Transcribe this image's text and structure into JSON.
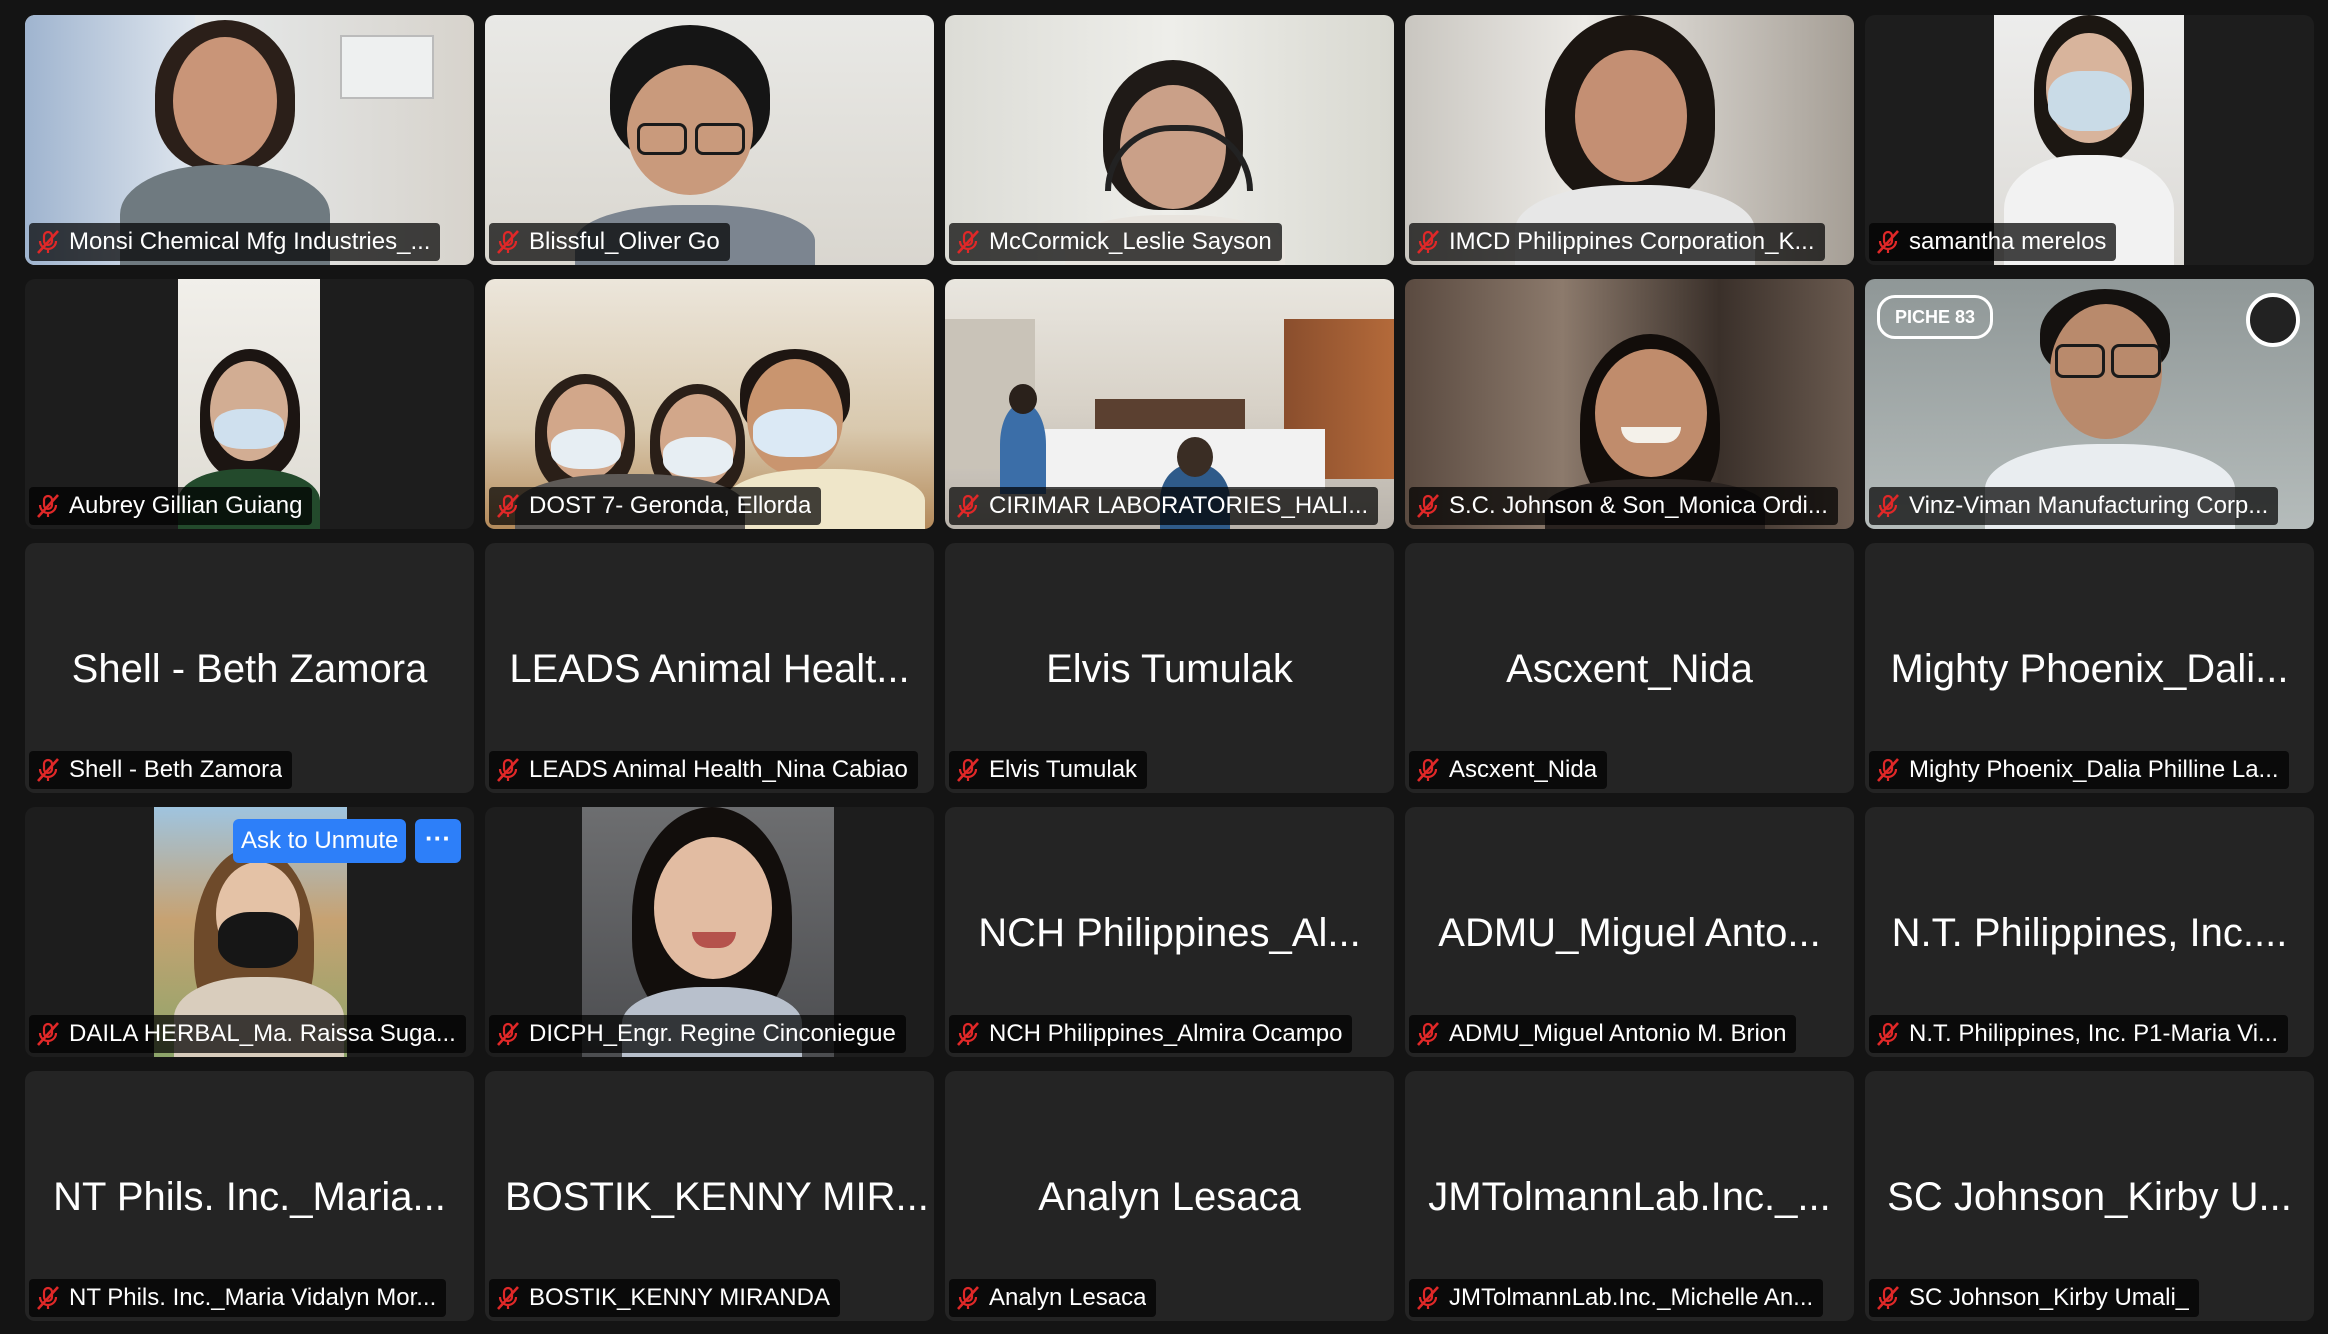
{
  "participants": [
    {
      "id": "t1",
      "name": "Monsi Chemical Mfg Industries_..."
    },
    {
      "id": "t2",
      "name": "Blissful_Oliver Go"
    },
    {
      "id": "t3",
      "name": "McCormick_Leslie Sayson"
    },
    {
      "id": "t4",
      "name": "IMCD Philippines Corporation_K..."
    },
    {
      "id": "t5",
      "name": "samantha merelos"
    },
    {
      "id": "t6",
      "name": "Aubrey Gillian Guiang"
    },
    {
      "id": "t7",
      "name": "DOST 7- Geronda, Ellorda"
    },
    {
      "id": "t8",
      "name": "CIRIMAR LABORATORIES_HALI..."
    },
    {
      "id": "t9",
      "name": "S.C. Johnson & Son_Monica Ordi..."
    },
    {
      "id": "t10",
      "name": "Vinz-Viman Manufacturing Corp..."
    },
    {
      "id": "t11",
      "name": "Shell - Beth Zamora",
      "display": "Shell - Beth Zamora"
    },
    {
      "id": "t12",
      "name": "LEADS Animal Health_Nina Cabiao",
      "display": "LEADS Animal Healt..."
    },
    {
      "id": "t13",
      "name": "Elvis Tumulak",
      "display": "Elvis Tumulak"
    },
    {
      "id": "t14",
      "name": "Ascxent_Nida",
      "display": "Ascxent_Nida"
    },
    {
      "id": "t15",
      "name": "Mighty Phoenix_Dalia Philline La...",
      "display": "Mighty Phoenix_Dali..."
    },
    {
      "id": "t16",
      "name": "DAILA HERBAL_Ma. Raissa Suga..."
    },
    {
      "id": "t17",
      "name": "DICPH_Engr. Regine Cinconiegue"
    },
    {
      "id": "t18",
      "name": "NCH Philippines_Almira Ocampo",
      "display": "NCH Philippines_Al..."
    },
    {
      "id": "t19",
      "name": "ADMU_Miguel Antonio M. Brion",
      "display": "ADMU_Miguel Anto..."
    },
    {
      "id": "t20",
      "name": "N.T. Philippines, Inc. P1-Maria Vi...",
      "display": "N.T. Philippines, Inc...."
    },
    {
      "id": "t21",
      "name": "NT Phils. Inc._Maria Vidalyn Mor...",
      "display": "NT Phils. Inc._Maria..."
    },
    {
      "id": "t22",
      "name": "BOSTIK_KENNY MIRANDA",
      "display": "BOSTIK_KENNY MIR..."
    },
    {
      "id": "t23",
      "name": "Analyn Lesaca",
      "display": "Analyn Lesaca"
    },
    {
      "id": "t24",
      "name": "JMTolmannLab.Inc._Michelle An...",
      "display": "JMTolmannLab.Inc._..."
    },
    {
      "id": "t25",
      "name": "SC Johnson_Kirby Umali_",
      "display": "SC Johnson_Kirby U..."
    }
  ],
  "hover_controls": {
    "ask_to_unmute": "Ask to Unmute",
    "more": "···"
  },
  "logo_text": "PICHE 83",
  "colors": {
    "tile": "#242424",
    "accent": "#2d7ff9",
    "muted_icon": "#e02828"
  },
  "icons": {
    "muted": "microphone-muted-icon"
  }
}
